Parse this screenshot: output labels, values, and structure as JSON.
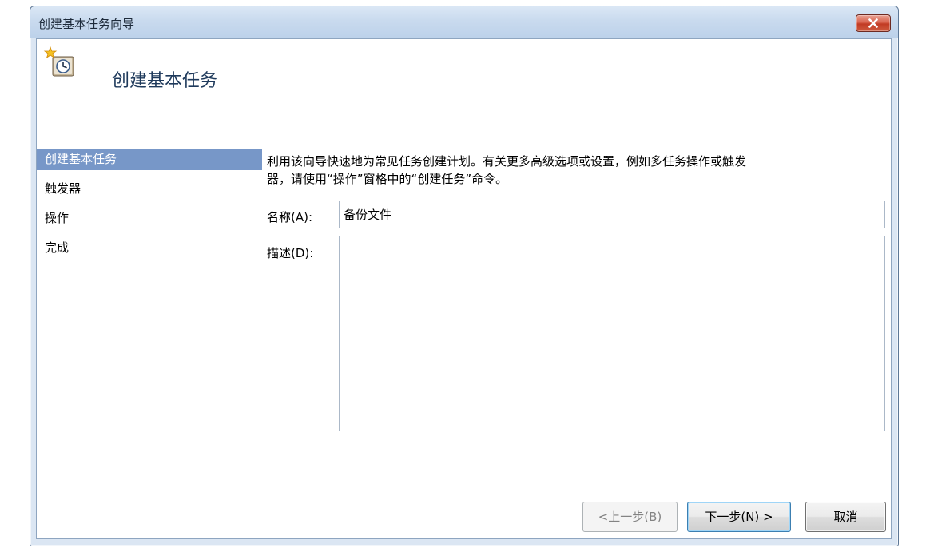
{
  "window": {
    "title": "创建基本任务向导"
  },
  "header": {
    "title": "创建基本任务",
    "icon": "task-scheduler-icon"
  },
  "nav": {
    "items": [
      {
        "label": "创建基本任务",
        "active": true
      },
      {
        "label": "触发器",
        "active": false
      },
      {
        "label": "操作",
        "active": false
      },
      {
        "label": "完成",
        "active": false
      }
    ]
  },
  "main": {
    "description_line1": "利用该向导快速地为常见任务创建计划。有关更多高级选项或设置，例如多任务操作或触发",
    "description_line2": "器，请使用“操作”窗格中的“创建任务”命令。",
    "name_label": "名称(A):",
    "name_value": "备份文件",
    "desc_label": "描述(D):",
    "desc_value": ""
  },
  "buttons": {
    "back": "<上一步(B)",
    "next": "下一步(N) >",
    "cancel": "取消"
  },
  "colors": {
    "nav_active_bg": "#7797c8",
    "close_button": "#c13b24",
    "header_title": "#1e395b"
  }
}
